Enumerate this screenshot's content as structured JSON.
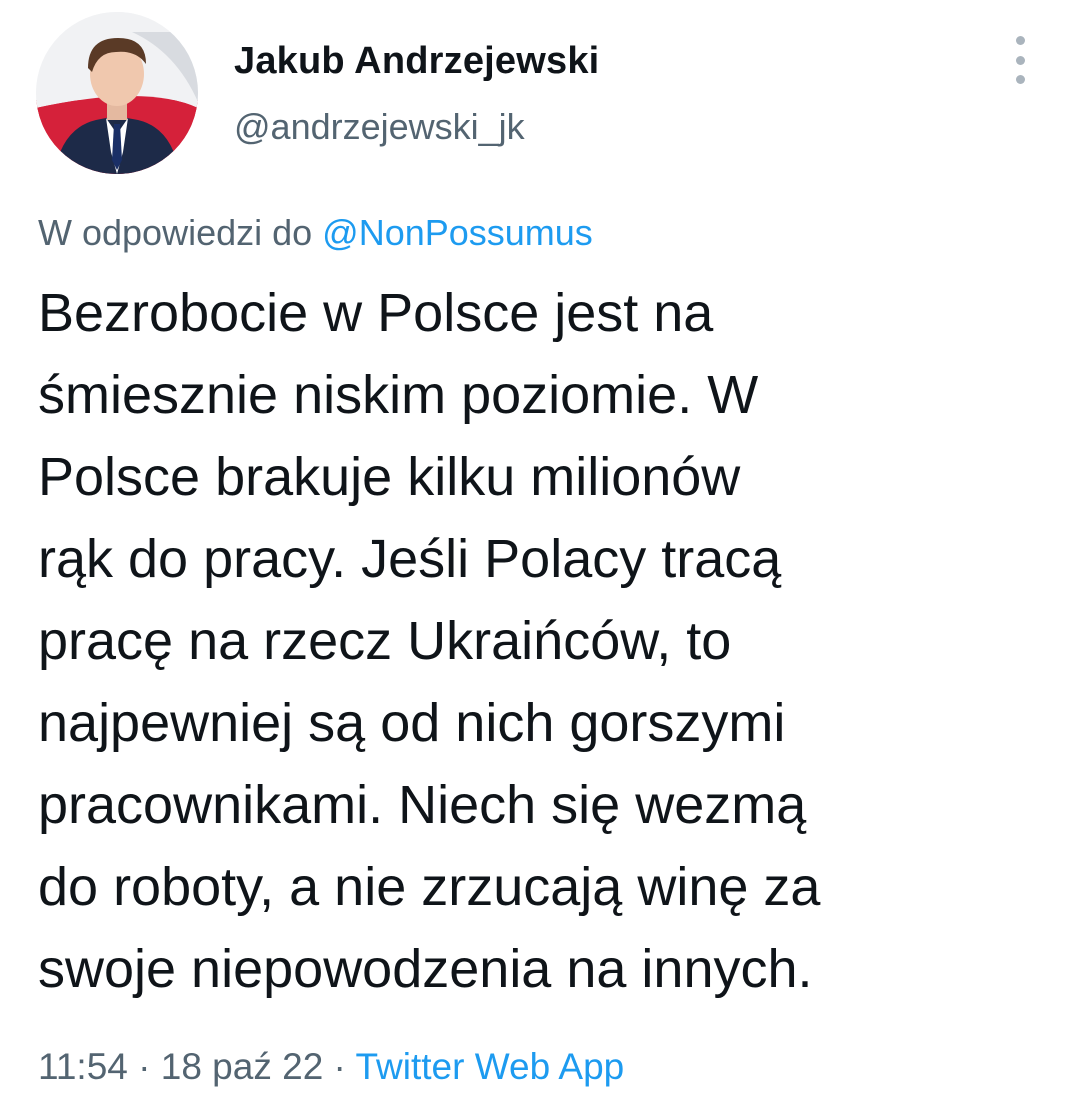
{
  "author": {
    "name": "Jakub Andrzejewski",
    "handle": "@andrzejewski_jk"
  },
  "reply_context": {
    "prefix": "W odpowiedzi do ",
    "mention": "@NonPossumus"
  },
  "tweet": {
    "lines": [
      "Bezrobocie w Polsce jest na",
      "śmiesznie niskim poziomie. W",
      "Polsce brakuje kilku milionów",
      "rąk do pracy. Jeśli Polacy tracą",
      "pracę na rzecz Ukraińców, to",
      "najpewniej są od nich gorszymi",
      "pracownikami. Niech się wezmą",
      "do roboty, a nie zrzucają winę za",
      "swoje niepowodzenia na innych."
    ]
  },
  "meta": {
    "time": "11:54",
    "separator": " · ",
    "date": "18 paź 22",
    "source": "Twitter Web App"
  },
  "icons": {
    "more": "more-vertical-icon"
  },
  "colors": {
    "link": "#1d9bf0",
    "secondary_text": "#536471",
    "primary_text": "#0f1419"
  }
}
